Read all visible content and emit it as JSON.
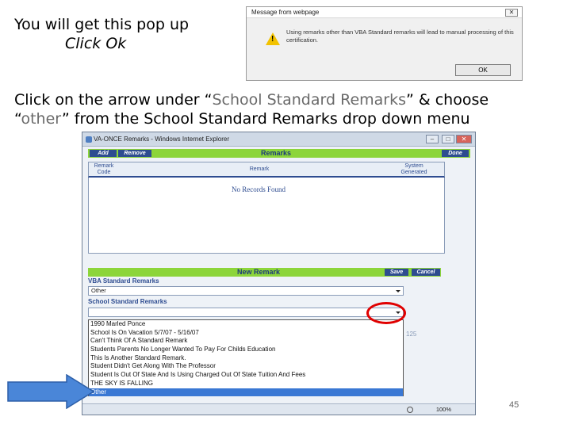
{
  "captions": {
    "line1": "You will get this pop up",
    "line2": "Click Ok",
    "line3_a": "Click on the arrow under “",
    "line3_b": "School Standard Remarks",
    "line3_c": "” & choose",
    "line4_a": "“",
    "line4_b": "other",
    "line4_c": "” from the School Standard Remarks drop down menu",
    "page_number": "45"
  },
  "message_box": {
    "title": "Message from webpage",
    "text": "Using remarks other than VBA Standard remarks will lead to manual processing of this certification.",
    "ok_label": "OK",
    "close_glyph": "✕",
    "icon": "warning-icon",
    "warning_color": "#f2c200"
  },
  "window": {
    "title": "VA-ONCE Remarks - Windows Internet Explorer",
    "minimize_glyph": "–",
    "maximize_glyph": "□",
    "close_glyph": "✕",
    "toolbar": {
      "add_label": "Add",
      "remove_label": "Remove",
      "section_title": "Remarks",
      "done_label": "Done"
    },
    "table": {
      "columns": [
        "Remark Code",
        "Remark",
        "System Generated"
      ],
      "empty_text": "No Records Found"
    },
    "new_remark": {
      "title": "New Remark",
      "save_label": "Save",
      "cancel_label": "Cancel",
      "vba_label": "VBA Standard Remarks",
      "vba_value": "Other",
      "school_label": "School Standard Remarks",
      "counter": "125",
      "dropdown_options": [
        "1990 Marled Ponce",
        "School Is On Vacation 5/7/07 - 5/16/07",
        "Can't Think Of A Standard Remark",
        "Students Parents No Longer Wanted To Pay For Childs Education",
        "This Is Another Standard Remark.",
        "Student Didn't Get Along With The Professor",
        "Student Is Out Of State And Is Using Charged Out Of State Tuition And Fees",
        "THE SKY IS FALLING",
        "Other"
      ],
      "selected_option": "Other"
    },
    "status_bar": {
      "zoom": "100%"
    }
  },
  "colors": {
    "green_bar": "#8cd53a",
    "button_navy": "#2e4c90",
    "highlight_red": "#e00000",
    "arrow_blue": "#4a86d8",
    "selection_blue": "#3a78d4"
  }
}
